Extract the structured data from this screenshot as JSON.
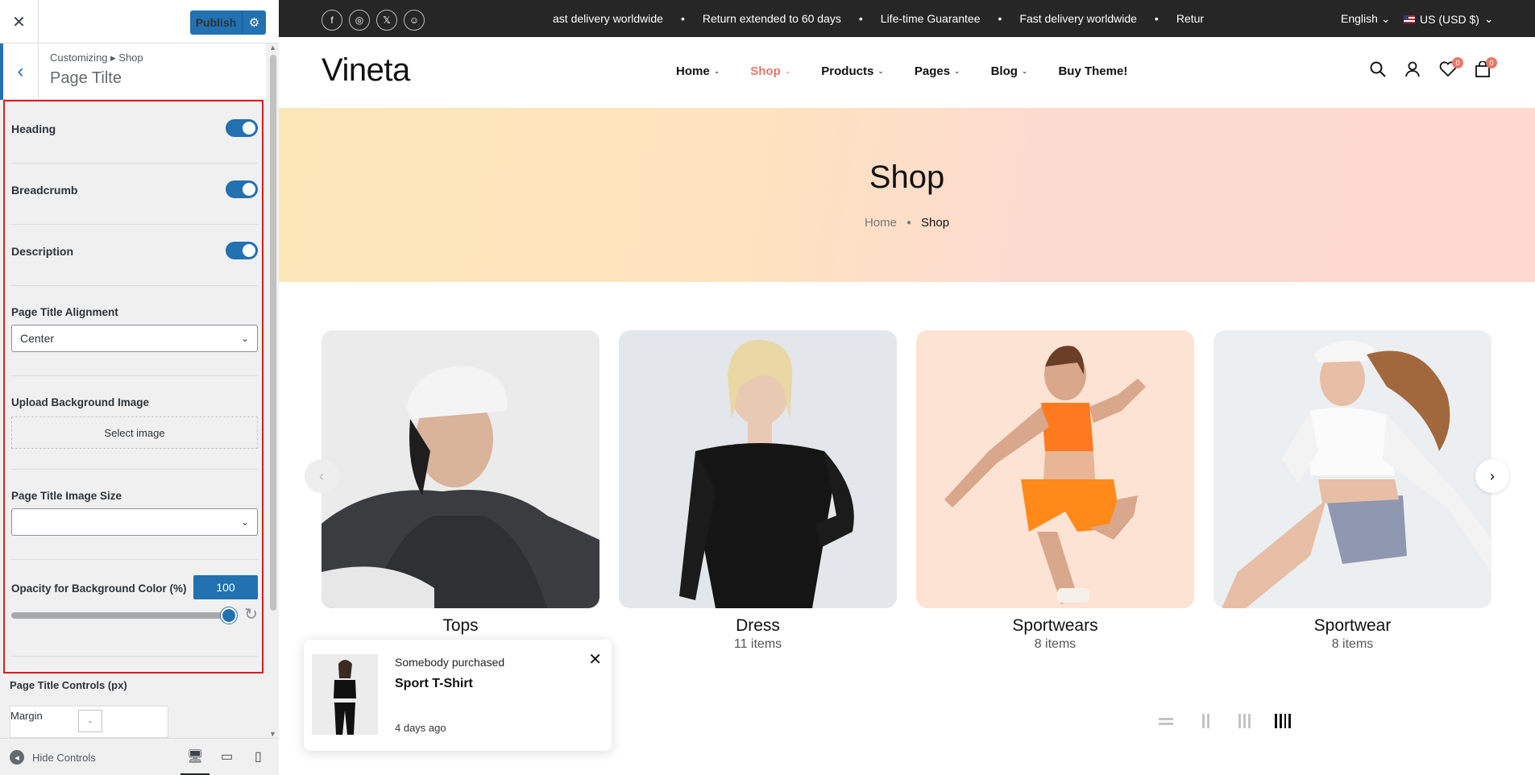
{
  "customizer": {
    "close": "✕",
    "publish": "Publish",
    "breadcrumb": "Customizing ▸ Shop",
    "title": "Page Tilte",
    "heading_label": "Heading",
    "breadcrumb_label": "Breadcrumb",
    "description_label": "Description",
    "alignment_label": "Page Title Alignment",
    "alignment_value": "Center",
    "upload_label": "Upload Background Image",
    "select_image": "Select image",
    "image_size_label": "Page Title Image Size",
    "image_size_value": "",
    "opacity_label": "Opacity for Background Color (%)",
    "opacity_value": "100",
    "controls_label": "Page Title Controls (px)",
    "margin_label": "Margin",
    "margin_value": "-",
    "hide_controls": "Hide Controls",
    "toggles": {
      "heading": true,
      "breadcrumb": true,
      "description": true
    },
    "opacity_percent": 100,
    "accent": "#2271b1",
    "highlight": "#e21b1b"
  },
  "site": {
    "ticker": [
      "ast delivery worldwide",
      "Return extended to 60 days",
      "Life-time Guarantee",
      "Fast delivery worldwide",
      "Retur"
    ],
    "language": "English",
    "currency": "US (USD $)",
    "logo": "Vineta",
    "nav": [
      "Home",
      "Shop",
      "Products",
      "Pages",
      "Blog",
      "Buy Theme!"
    ],
    "wishlist_count": "0",
    "cart_count": "0",
    "hero_title": "Shop",
    "crumb_home": "Home",
    "crumb_current": "Shop",
    "hero_colors": [
      "#fde6b8",
      "#fdd9d0"
    ],
    "categories": [
      {
        "name": "Tops",
        "count": ""
      },
      {
        "name": "Dress",
        "count": "11 items"
      },
      {
        "name": "Sportwears",
        "count": "8 items"
      },
      {
        "name": "Sportwear",
        "count": "8 items"
      }
    ],
    "toast": {
      "line1": "Somebody purchased",
      "product": "Sport T-Shirt",
      "time": "4 days ago"
    },
    "brand_accent": "#e8766a"
  }
}
